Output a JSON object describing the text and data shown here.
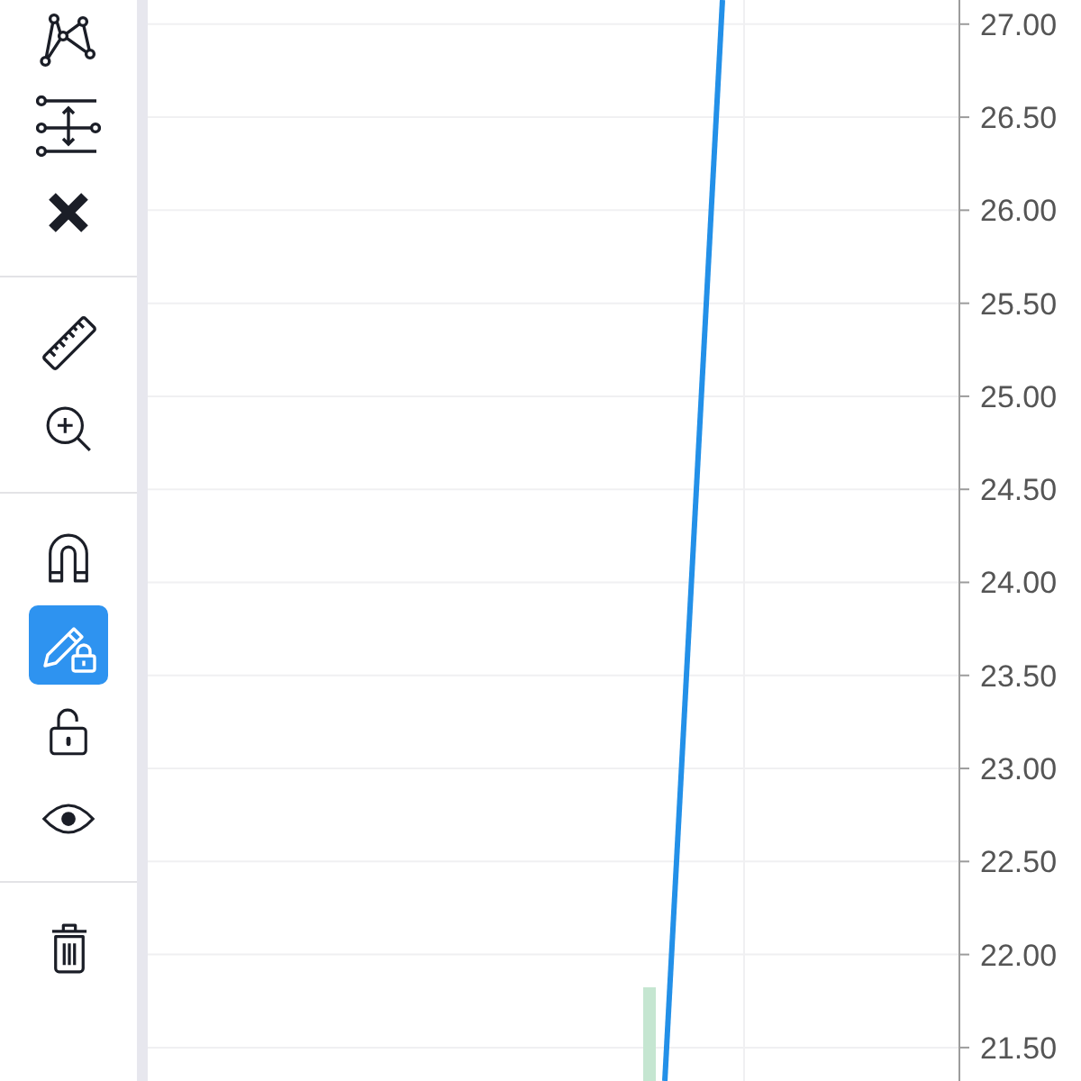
{
  "toolbar": {
    "groups": [
      {
        "items": [
          {
            "kind": "pattern",
            "selected": false
          },
          {
            "kind": "adjust",
            "selected": false
          },
          {
            "kind": "remove",
            "selected": false
          }
        ]
      },
      {
        "items": [
          {
            "kind": "ruler",
            "selected": false
          },
          {
            "kind": "zoom",
            "selected": false
          }
        ]
      },
      {
        "items": [
          {
            "kind": "magnet",
            "selected": false
          },
          {
            "kind": "lock-drawing",
            "selected": true
          },
          {
            "kind": "unlock",
            "selected": false
          },
          {
            "kind": "eye",
            "selected": false
          }
        ]
      },
      {
        "items": [
          {
            "kind": "trash",
            "selected": false
          }
        ]
      }
    ]
  },
  "price_axis": {
    "labels": [
      "27.00",
      "26.50",
      "26.00",
      "25.50",
      "25.00",
      "24.50",
      "24.00",
      "23.50",
      "23.00",
      "22.50",
      "22.00",
      "21.50"
    ]
  }
}
